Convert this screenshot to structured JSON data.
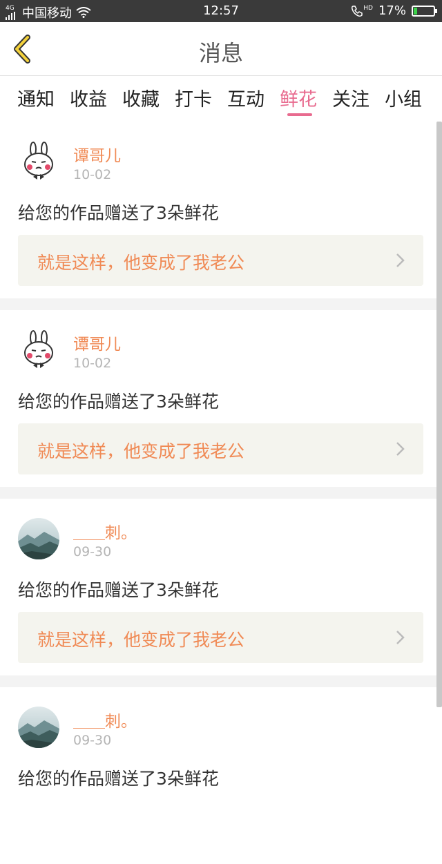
{
  "status": {
    "network_type": "4G",
    "carrier": "中国移动",
    "time": "12:57",
    "hd_label": "HD",
    "battery_percent": "17%",
    "battery_level": 0.17
  },
  "nav": {
    "title": "消息",
    "back_icon": "chevron-left-icon"
  },
  "tabs": [
    {
      "label": "通知"
    },
    {
      "label": "收益"
    },
    {
      "label": "收藏"
    },
    {
      "label": "打卡"
    },
    {
      "label": "互动"
    },
    {
      "label": "鲜花",
      "active": true
    },
    {
      "label": "关注"
    },
    {
      "label": "小组"
    }
  ],
  "colors": {
    "accent_pink": "#e86b8f",
    "accent_orange": "#f08a55",
    "status_bar": "#3a3a3a",
    "link_bg": "#f4f4ee"
  },
  "messages": [
    {
      "user": "谭哥儿",
      "date": "10-02",
      "text": "给您的作品赠送了3朵鲜花",
      "work_title": "就是这样，他变成了我老公",
      "avatar": "rabbit-avatar"
    },
    {
      "user": "谭哥儿",
      "date": "10-02",
      "text": "给您的作品赠送了3朵鲜花",
      "work_title": "就是这样，他变成了我老公",
      "avatar": "rabbit-avatar"
    },
    {
      "user": "＿＿刺。",
      "date": "09-30",
      "text": "给您的作品赠送了3朵鲜花",
      "work_title": "就是这样，他变成了我老公",
      "avatar": "mountain-avatar"
    },
    {
      "user": "＿＿刺。",
      "date": "09-30",
      "text": "给您的作品赠送了3朵鲜花",
      "work_title": "",
      "avatar": "mountain-avatar"
    }
  ]
}
